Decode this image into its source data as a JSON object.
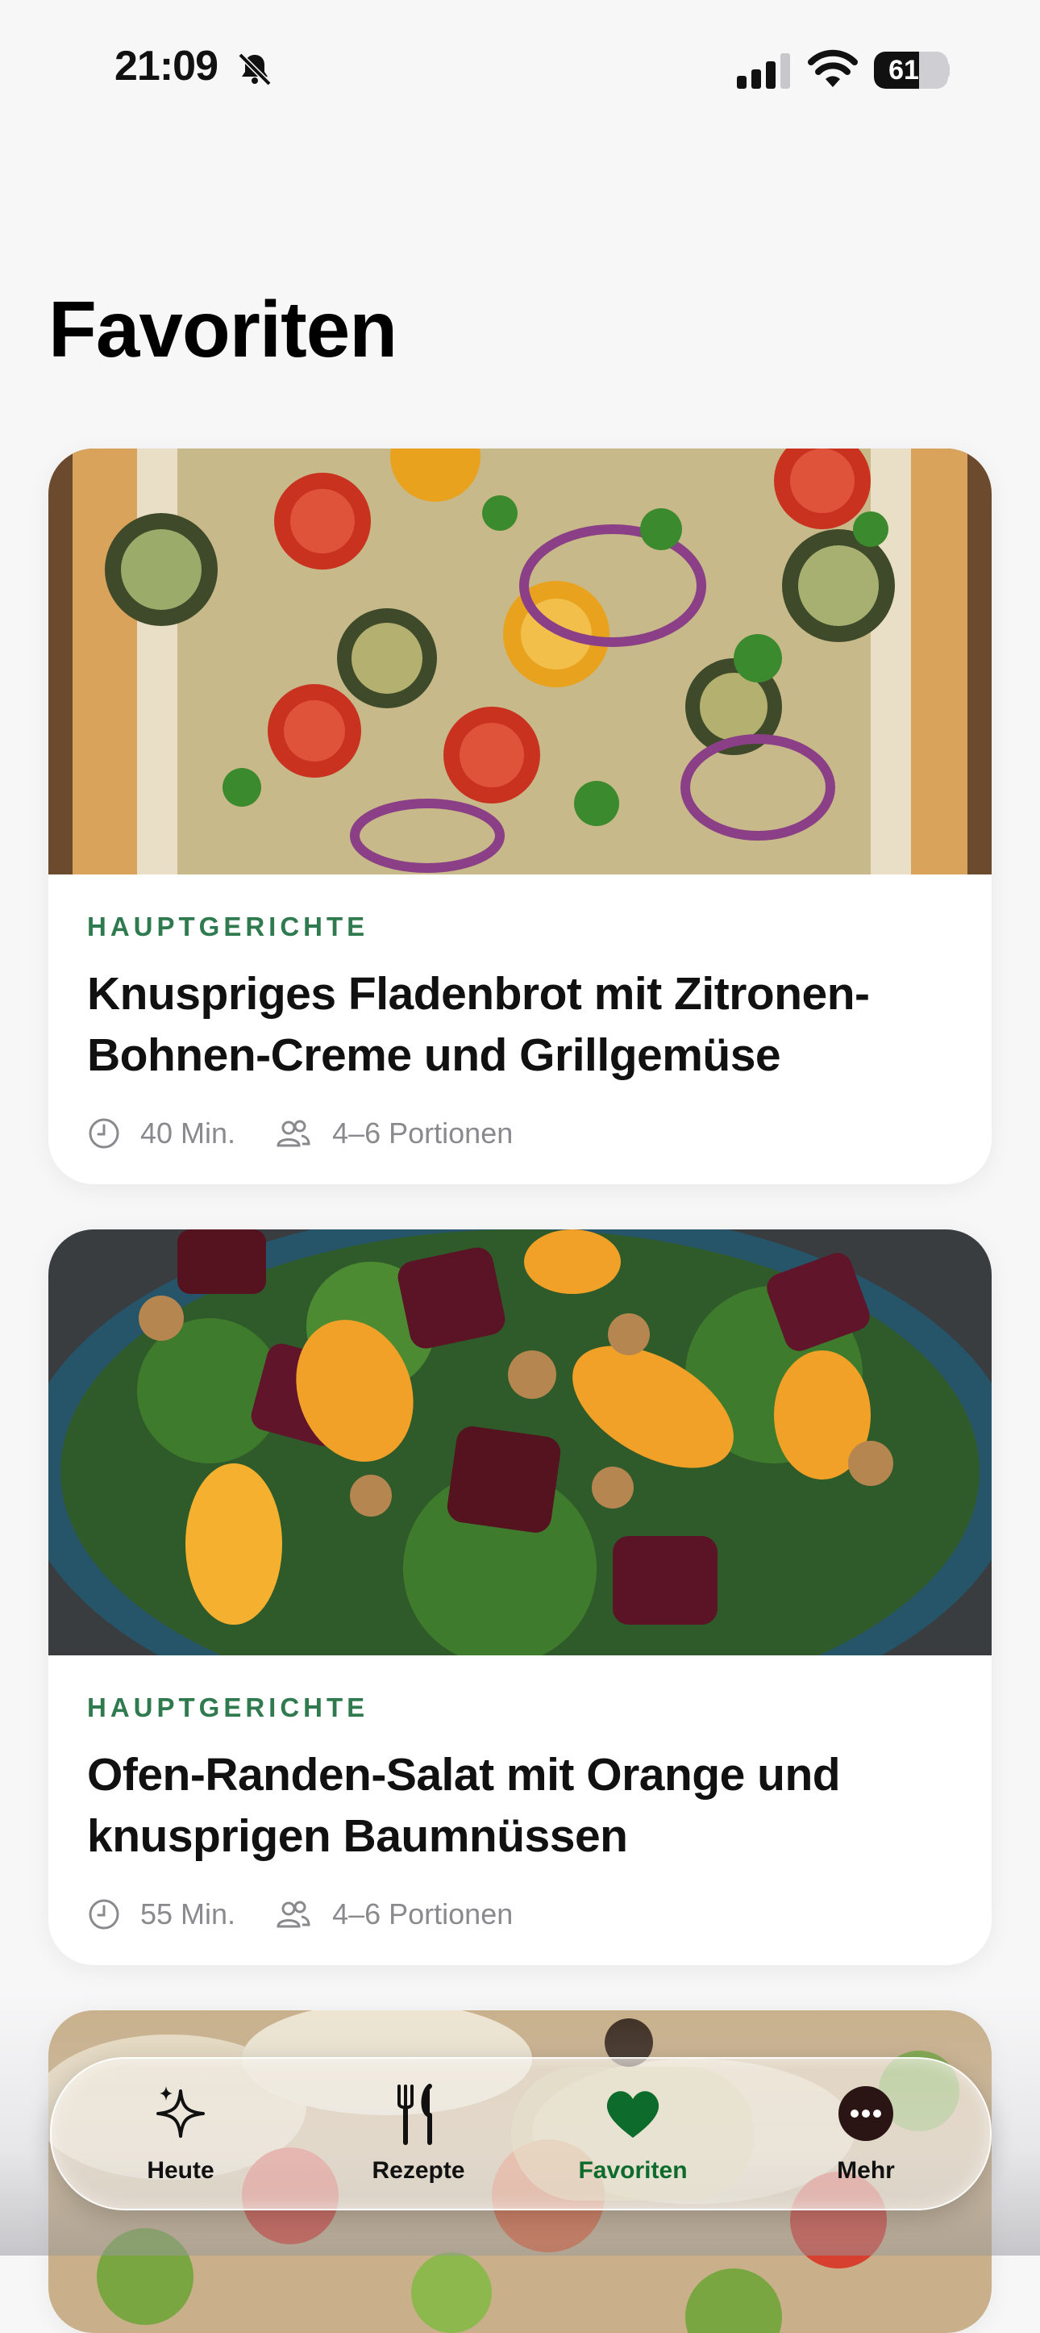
{
  "status_bar": {
    "time": "21:09",
    "battery_level": "61",
    "battery_fraction": 0.61
  },
  "page": {
    "title": "Favoriten"
  },
  "recipes": [
    {
      "category": "HAUPTGERICHTE",
      "title": "Knuspriges Fladenbrot mit Zitronen-Bohnen-Creme und Grillgemüse",
      "time": "40 Min.",
      "servings": "4–6 Portionen"
    },
    {
      "category": "HAUPTGERICHTE",
      "title": "Ofen-Randen-Salat mit Orange und knusprigen Baumnüssen",
      "time": "55 Min.",
      "servings": "4–6 Portionen"
    }
  ],
  "tab_bar": {
    "tabs": [
      {
        "label": "Heute",
        "icon": "sparkles-icon"
      },
      {
        "label": "Rezepte",
        "icon": "fork-knife-icon"
      },
      {
        "label": "Favoriten",
        "icon": "heart-icon",
        "active": true
      },
      {
        "label": "Mehr",
        "icon": "ellipsis-circle-icon"
      }
    ]
  },
  "colors": {
    "accent": "#2f7a4f",
    "active_tab": "#0d6b2c",
    "background": "#f7f7f8"
  }
}
